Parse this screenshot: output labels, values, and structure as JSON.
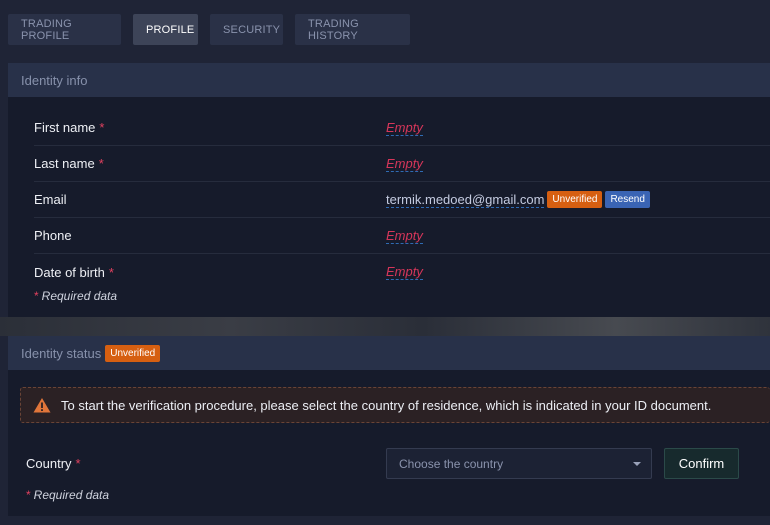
{
  "tabs": [
    {
      "label": "TRADING PROFILE",
      "active": false
    },
    {
      "label": "PROFILE",
      "active": true
    },
    {
      "label": "SECURITY",
      "active": false
    },
    {
      "label": "TRADING HISTORY",
      "active": false
    }
  ],
  "identity_info": {
    "title": "Identity info",
    "fields": [
      {
        "label": "First name",
        "required": "*",
        "value": "Empty"
      },
      {
        "label": "Last name",
        "required": "*",
        "value": "Empty"
      },
      {
        "label": "Email",
        "required": "",
        "value": "termik.medoed@gmail.com",
        "badge": "Unverified",
        "action": "Resend"
      },
      {
        "label": "Phone",
        "required": "",
        "value": "Empty"
      },
      {
        "label": "Date of birth",
        "required": "*",
        "value": "Empty"
      }
    ],
    "required_note_star": "*",
    "required_note": "Required data"
  },
  "identity_status": {
    "title": "Identity status",
    "badge": "Unverified",
    "alert": "To start the verification procedure, please select the country of residence, which is indicated in your ID document.",
    "country_label": "Country",
    "country_required": "*",
    "country_placeholder": "Choose the country",
    "confirm_label": "Confirm",
    "required_note_star": "*",
    "required_note": "Required data"
  },
  "colors": {
    "accent_orange": "#d65f11",
    "accent_blue": "#3a64b4",
    "required_red": "#e2415f"
  }
}
